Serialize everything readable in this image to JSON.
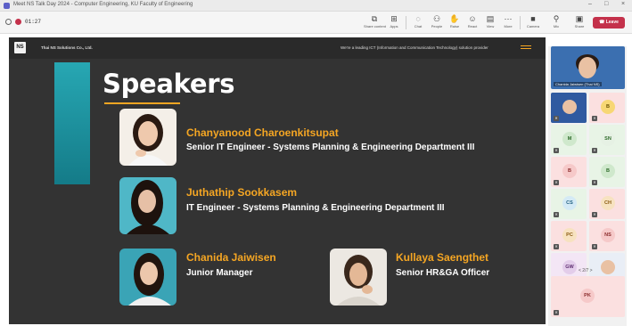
{
  "window": {
    "title": "Meet NS Talk Day 2024 - Computer Engineering, KU Faculty of Engineering"
  },
  "toolbar": {
    "timer": "01:27",
    "buttons": [
      {
        "icon": "share-screen-icon",
        "label": "Share content"
      },
      {
        "icon": "more-apps-icon",
        "label": "Apps"
      },
      {
        "icon": "chat-icon",
        "label": "Chat"
      },
      {
        "icon": "people-icon",
        "label": "People"
      },
      {
        "icon": "raise-hand-icon",
        "label": "Raise"
      },
      {
        "icon": "react-icon",
        "label": "React"
      },
      {
        "icon": "view-icon",
        "label": "View"
      },
      {
        "icon": "more-icon",
        "label": "More"
      },
      {
        "icon": "camera-icon",
        "label": "Camera"
      },
      {
        "icon": "mic-icon",
        "label": "Mic"
      },
      {
        "icon": "share-icon",
        "label": "Share"
      }
    ],
    "leave_label": "Leave"
  },
  "slide": {
    "company": "Thai NS Solutions Co., Ltd.",
    "tagline": "We're a leading ICT (Information and Communication Technology) solution provider",
    "logo_text": "NS",
    "heading": "Speakers",
    "speakers": [
      {
        "name": "Chanyanood Charoenkitsupat",
        "role": "Senior IT Engineer - Systems Planning & Engineering Department III"
      },
      {
        "name": "Juthathip Sookkasem",
        "role": "IT Engineer - Systems Planning & Engineering Department III"
      },
      {
        "name": "Chanida Jaiwisen",
        "role": "Junior Manager"
      },
      {
        "name": "Kullaya Saengthet",
        "role": "Senior HR&GA Officer"
      }
    ],
    "colors": {
      "accent": "#f5a623",
      "teal": "#1b8f9b",
      "background": "#333333"
    }
  },
  "rail": {
    "featured_caption": "Chanida Jaiwisen (Thai NS)",
    "participants": [
      "B",
      "M",
      "SN",
      "B",
      "B",
      "CS",
      "CH",
      "PC",
      "NS",
      "GW",
      "PK"
    ],
    "pager": "< 2/7 >"
  }
}
